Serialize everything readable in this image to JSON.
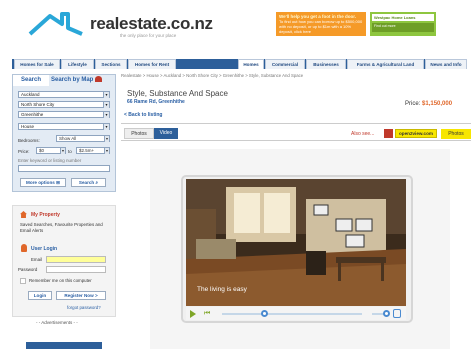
{
  "header": {
    "logo_text": "realestate.co.nz",
    "tagline": "the only place for your place",
    "ad_orange_line1": "We'll help you get a foot in the door.",
    "ad_orange_line2": "To find out how you can borrow up to $500,000 with no deposit, or up to $1m with a 10% deposit, click here",
    "ad_green_line1": "Westpac Home Loans",
    "ad_green_line2": "Find out more"
  },
  "nav": {
    "tabs": [
      "Homes for Sale",
      "Lifestyle",
      "Sections",
      "Homes for Rent",
      "Homes",
      "Commercial",
      "Businesses",
      "Farms & Agricultural Land",
      "News and Info"
    ]
  },
  "search": {
    "tab_search": "Search",
    "tab_map": "Search by Map",
    "region": "Auckland",
    "district": "North Shore City",
    "suburb": "Greenhithe",
    "type": "House",
    "bedrooms_label": "Bedrooms:",
    "bedrooms_value": "Show All",
    "price_label": "Price:",
    "price_from": "$0",
    "price_to_label": "to",
    "price_to": "$2.5m+",
    "listing_label": "Enter keyword or listing number",
    "more_options": "More options",
    "search_button": "Search"
  },
  "my_property": {
    "heading": "My Property",
    "desc": "Saved Searches, Favourite Properties and Email Alerts",
    "login_heading": "User Login",
    "email_label": "Email",
    "password_label": "Password",
    "remember_label": "Remember me on this computer",
    "login_button": "Login",
    "register_button": "Register Now",
    "forgot": "forgot password?",
    "advertisements": "- - Advertisements - -"
  },
  "listing": {
    "breadcrumb": "Realestate > House > Auckland > North Shore City > Greenhithe > Style, Substance And Space",
    "title": "Style, Substance And Space",
    "address": "66 Rame Rd, Greenhithe",
    "price_label": "Price:",
    "price": "$1,150,000",
    "back": "< Back to listing",
    "tab_photos": "Photos",
    "tab_video": "Video",
    "also_see": "Also see...",
    "open2view": "open2view.com",
    "photos_link": "Photos"
  },
  "video": {
    "caption": "The living is easy",
    "progress": 0.3
  },
  "colors": {
    "nav_blue": "#2d5f9a",
    "accent_red": "#c0392b",
    "price_orange": "#e0672a",
    "link_blue": "#2a5fa4",
    "player_green": "#7fa628"
  }
}
